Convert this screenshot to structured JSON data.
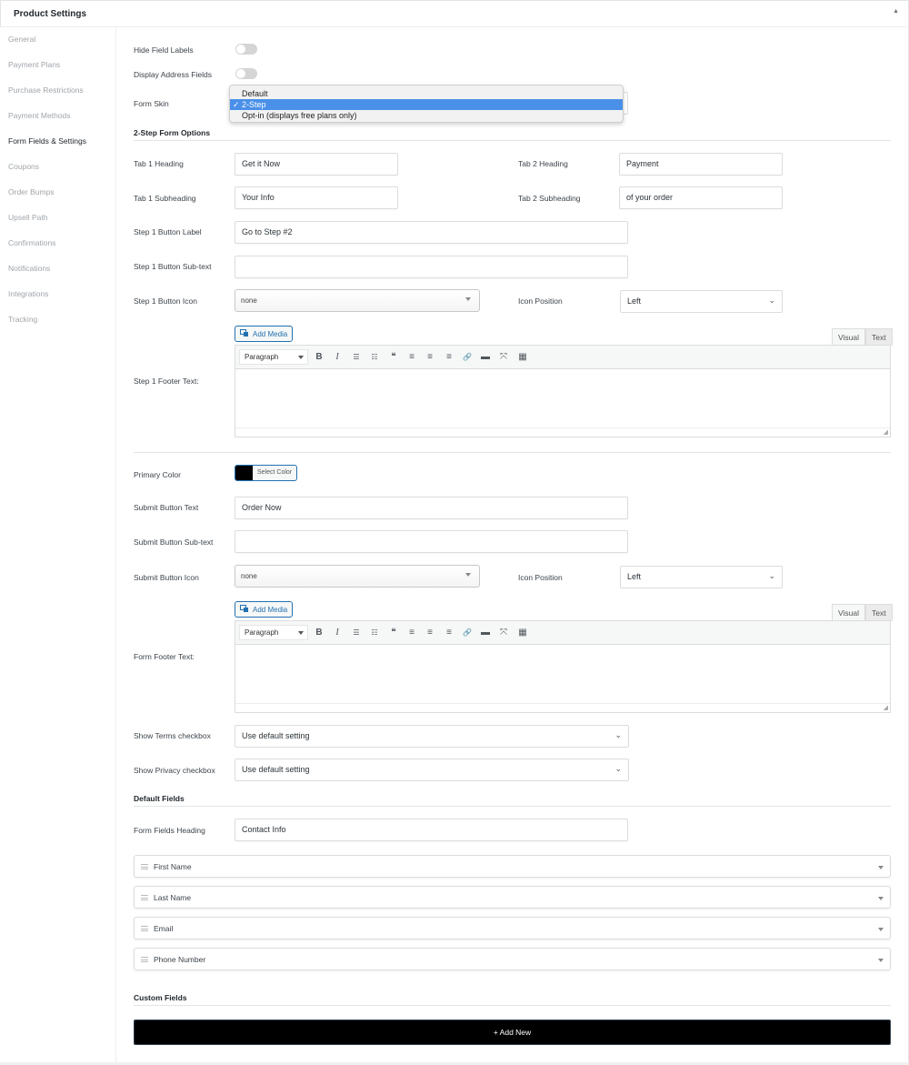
{
  "header": {
    "title": "Product Settings",
    "collapse_icon": "triangle-up"
  },
  "sidebar": {
    "items": [
      {
        "label": "General",
        "active": false
      },
      {
        "label": "Payment Plans",
        "active": false
      },
      {
        "label": "Purchase Restrictions",
        "active": false
      },
      {
        "label": "Payment Methods",
        "active": false
      },
      {
        "label": "Form Fields & Settings",
        "active": true
      },
      {
        "label": "Coupons",
        "active": false
      },
      {
        "label": "Order Bumps",
        "active": false
      },
      {
        "label": "Upsell Path",
        "active": false
      },
      {
        "label": "Confirmations",
        "active": false
      },
      {
        "label": "Notifications",
        "active": false
      },
      {
        "label": "Integrations",
        "active": false
      },
      {
        "label": "Tracking",
        "active": false
      }
    ]
  },
  "general": {
    "hide_field_labels": {
      "label": "Hide Field Labels",
      "on": false
    },
    "display_address_fields": {
      "label": "Display Address Fields",
      "on": false
    },
    "form_skin": {
      "label": "Form Skin",
      "selected": "2-Step",
      "options": [
        "Default",
        "2-Step",
        "Opt-in (displays free plans only)"
      ],
      "check": "✓"
    }
  },
  "two_step": {
    "title": "2-Step Form Options",
    "tab1_heading": {
      "label": "Tab 1 Heading",
      "value": "Get it Now"
    },
    "tab2_heading": {
      "label": "Tab 2 Heading",
      "value": "Payment"
    },
    "tab1_subheading": {
      "label": "Tab 1 Subheading",
      "value": "Your Info"
    },
    "tab2_subheading": {
      "label": "Tab 2 Subheading",
      "value": "of your order"
    },
    "step1_button_label": {
      "label": "Step 1 Button Label",
      "value": "Go to Step #2"
    },
    "step1_button_subtext": {
      "label": "Step 1 Button Sub-text",
      "value": ""
    },
    "step1_button_icon": {
      "label": "Step 1 Button Icon",
      "value": "none"
    },
    "step1_icon_position": {
      "label": "Icon Position",
      "value": "Left"
    },
    "step1_footer": {
      "label": "Step 1 Footer Text:"
    }
  },
  "editor": {
    "add_media": "Add Media",
    "visual_tab": "Visual",
    "text_tab": "Text",
    "format": "Paragraph",
    "tools": [
      {
        "name": "bold-icon",
        "glyph": "B"
      },
      {
        "name": "italic-icon",
        "glyph": "I"
      },
      {
        "name": "bullet-list-icon",
        "glyph": "☰"
      },
      {
        "name": "numbered-list-icon",
        "glyph": "☷"
      },
      {
        "name": "blockquote-icon",
        "glyph": "❝"
      },
      {
        "name": "align-left-icon",
        "glyph": "≡"
      },
      {
        "name": "align-center-icon",
        "glyph": "≡"
      },
      {
        "name": "align-right-icon",
        "glyph": "≡"
      },
      {
        "name": "link-icon",
        "glyph": "🔗"
      },
      {
        "name": "read-more-icon",
        "glyph": "▬"
      },
      {
        "name": "fullscreen-icon",
        "glyph": "⤧"
      },
      {
        "name": "toolbar-toggle-icon",
        "glyph": "▦"
      }
    ]
  },
  "submit": {
    "primary_color": {
      "label": "Primary Color",
      "button": "Select Color",
      "color": "#000000"
    },
    "button_text": {
      "label": "Submit Button Text",
      "value": "Order Now"
    },
    "button_subtext": {
      "label": "Submit Button Sub-text",
      "value": ""
    },
    "button_icon": {
      "label": "Submit Button Icon",
      "value": "none"
    },
    "icon_position": {
      "label": "Icon Position",
      "value": "Left"
    },
    "form_footer": {
      "label": "Form Footer Text:"
    },
    "show_terms": {
      "label": "Show Terms checkbox",
      "value": "Use default setting"
    },
    "show_privacy": {
      "label": "Show Privacy checkbox",
      "value": "Use default setting"
    }
  },
  "default_fields": {
    "title": "Default Fields",
    "heading": {
      "label": "Form Fields Heading",
      "value": "Contact Info"
    },
    "fields": [
      "First Name",
      "Last Name",
      "Email",
      "Phone Number"
    ]
  },
  "custom_fields": {
    "title": "Custom Fields",
    "add_new": "+ Add New"
  }
}
